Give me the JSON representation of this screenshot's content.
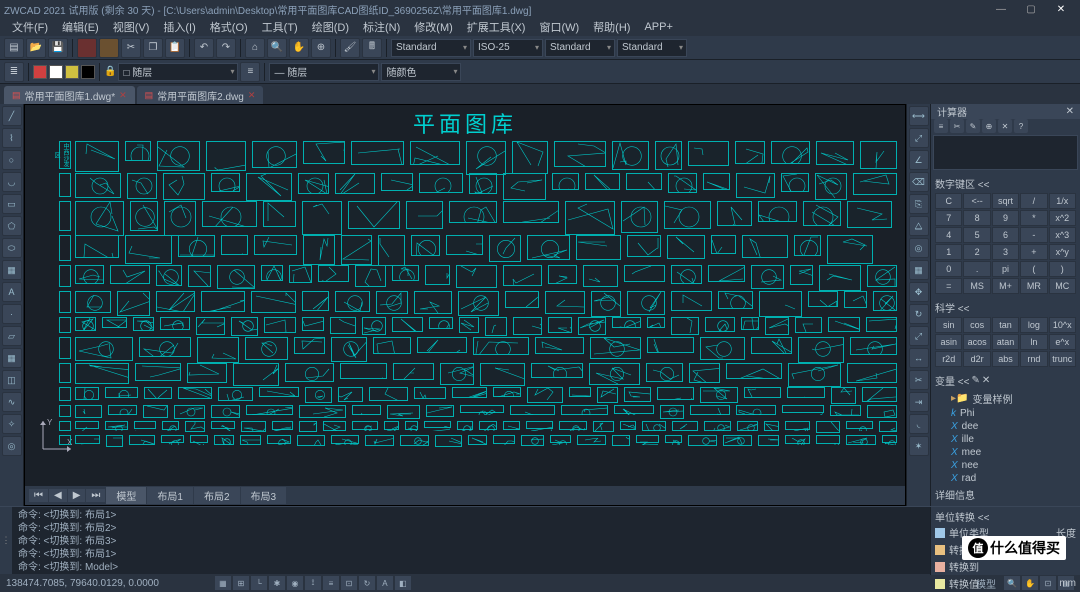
{
  "app": {
    "title": "ZWCAD 2021 试用版 (剩余 30 天) - [C:\\Users\\admin\\Desktop\\常用平面图库CAD图纸ID_3690256Z\\常用平面图库1.dwg]",
    "win_min": "—",
    "win_max": "▢",
    "win_close": "✕"
  },
  "menu": [
    "文件(F)",
    "编辑(E)",
    "视图(V)",
    "插入(I)",
    "格式(O)",
    "工具(T)",
    "绘图(D)",
    "标注(N)",
    "修改(M)",
    "扩展工具(X)",
    "窗口(W)",
    "帮助(H)",
    "APP+"
  ],
  "toolbar1": {
    "layer_lock": "🔒",
    "layer_combo": "□ 随层",
    "linetype": "— 随层",
    "color": "随颜色",
    "std1": "Standard",
    "std2": "ISO-25",
    "std3": "Standard",
    "std4": "Standard"
  },
  "doc_tabs": [
    {
      "label": "常用平面图库1.dwg*",
      "active": true
    },
    {
      "label": "常用平面图库2.dwg"
    }
  ],
  "drawing": {
    "title": "平面图库",
    "axis_x": "X",
    "axis_y": "Y"
  },
  "side_labels": [
    "中西沙发区",
    "",
    "",
    "",
    "",
    "",
    "",
    "",
    ""
  ],
  "layouts": {
    "model": "模型",
    "tabs": [
      "布局1",
      "布局2",
      "布局3"
    ],
    "nav_first": "⏮",
    "nav_prev": "◀",
    "nav_next": "▶",
    "nav_last": "⏭"
  },
  "calc": {
    "title": "计算器",
    "numeric_hdr": "数字键区 <<",
    "keys_num": [
      [
        "C",
        "<--",
        "sqrt",
        "/",
        "1/x"
      ],
      [
        "7",
        "8",
        "9",
        "*",
        "x^2"
      ],
      [
        "4",
        "5",
        "6",
        "-",
        "x^3"
      ],
      [
        "1",
        "2",
        "3",
        "+",
        "x^y"
      ],
      [
        "0",
        ".",
        "pi",
        "(",
        ")"
      ],
      [
        "=",
        "MS",
        "M+",
        "MR",
        "MC"
      ]
    ],
    "sci_hdr": "科学 <<",
    "keys_sci": [
      [
        "sin",
        "cos",
        "tan",
        "log",
        "10^x"
      ],
      [
        "asin",
        "acos",
        "atan",
        "ln",
        "e^x"
      ],
      [
        "r2d",
        "d2r",
        "abs",
        "rnd",
        "trunc"
      ]
    ],
    "var_hdr": "变量 <<",
    "var_sample": "变量样例",
    "vars": [
      {
        "t": "k",
        "n": "Phi"
      },
      {
        "t": "X",
        "n": "dee"
      },
      {
        "t": "X",
        "n": "ille"
      },
      {
        "t": "X",
        "n": "mee"
      },
      {
        "t": "X",
        "n": "nee"
      },
      {
        "t": "X",
        "n": "rad"
      }
    ],
    "detail": "详细信息"
  },
  "unit": {
    "title": "单位转换 <<",
    "rows": [
      {
        "label": "单位类型",
        "val": "长度"
      },
      {
        "label": "转换自",
        "val": ""
      },
      {
        "label": "转换到",
        "val": ""
      },
      {
        "label": "转换值",
        "val": "mm"
      }
    ]
  },
  "cmd": {
    "lines": [
      "命令: <切换到: 布局1>",
      "命令: <切换到: 布局2>",
      "命令: <切换到: 布局3>",
      "命令: <切换到: 布局1>",
      "命令: <切换到: Model>"
    ],
    "prompt": "命令:"
  },
  "status": {
    "coords": "138474.7085,  79640.0129,  0.0000",
    "model_paper": "模型"
  },
  "brand": "什么值得买"
}
